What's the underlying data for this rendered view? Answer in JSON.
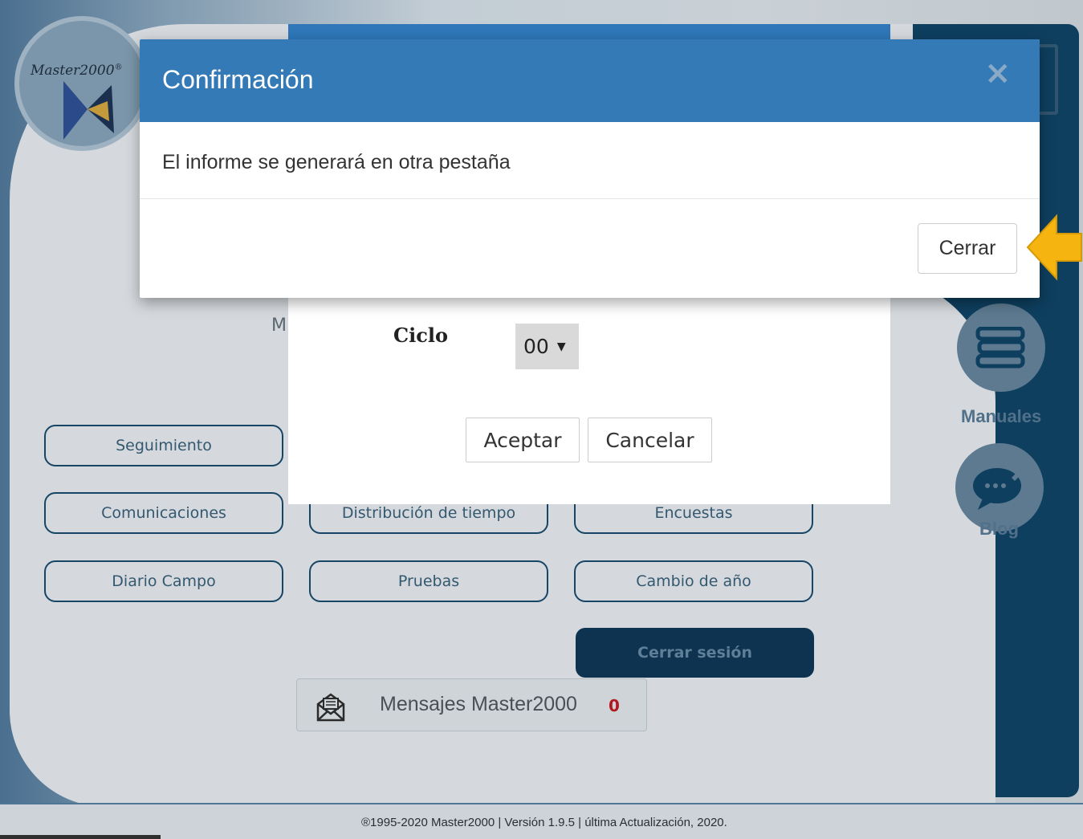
{
  "app": {
    "logo_text": "Master2000",
    "logo_trademark": "®"
  },
  "sidebar": {
    "manuales_label": "Manuales",
    "blog_label": "Blog"
  },
  "menu": {
    "buttons": [
      {
        "label": "Seguimiento"
      },
      {
        "label": "Comunicaciones"
      },
      {
        "label": "Distribución de tiempo"
      },
      {
        "label": "Encuestas"
      },
      {
        "label": "Diario Campo"
      },
      {
        "label": "Pruebas"
      },
      {
        "label": "Cambio de año"
      }
    ],
    "logout_label": "Cerrar sesión",
    "partial_letter": "M"
  },
  "messages": {
    "label": "Mensajes Master2000",
    "count": "0",
    "icon": "envelope-icon"
  },
  "report_dialog": {
    "ciclo_label": "Ciclo",
    "ciclo_value": "00",
    "accept_label": "Aceptar",
    "cancel_label": "Cancelar"
  },
  "modal": {
    "title": "Confirmación",
    "close_symbol": "×",
    "message": "El informe se generará en otra pestaña",
    "close_button_label": "Cerrar"
  },
  "footer": {
    "text": "®1995-2020 Master2000 | Versión 1.9.5 | última Actualización, 2020."
  },
  "colors": {
    "modal_header": "#337ab7",
    "sidebar": "#0e3f5f",
    "arrow": "#f5b40f"
  }
}
